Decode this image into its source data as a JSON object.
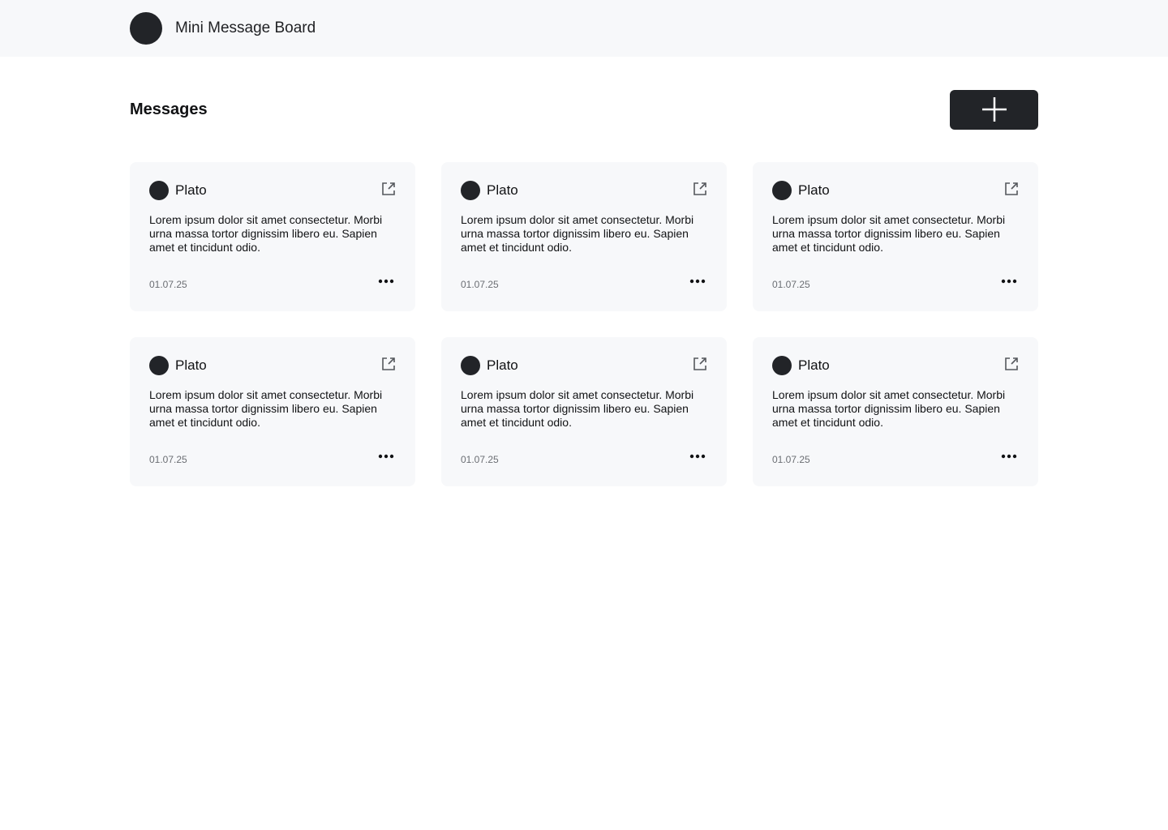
{
  "header": {
    "title": "Mini Message Board",
    "logo_icon": "circle-logo-icon"
  },
  "toolbar": {
    "title": "Messages",
    "add_icon": "plus-icon"
  },
  "messages": [
    {
      "author": "Plato",
      "text": "Lorem ipsum dolor sit amet consectetur. Morbi urna massa tortor dignissim libero eu. Sapien amet et tincidunt odio.",
      "date": "01.07.25"
    },
    {
      "author": "Plato",
      "text": "Lorem ipsum dolor sit amet consectetur. Morbi urna massa tortor dignissim libero eu. Sapien amet et tincidunt odio.",
      "date": "01.07.25"
    },
    {
      "author": "Plato",
      "text": "Lorem ipsum dolor sit amet consectetur. Morbi urna massa tortor dignissim libero eu. Sapien amet et tincidunt odio.",
      "date": "01.07.25"
    },
    {
      "author": "Plato",
      "text": "Lorem ipsum dolor sit amet consectetur. Morbi urna massa tortor dignissim libero eu. Sapien amet et tincidunt odio.",
      "date": "01.07.25"
    },
    {
      "author": "Plato",
      "text": "Lorem ipsum dolor sit amet consectetur. Morbi urna massa tortor dignissim libero eu. Sapien amet et tincidunt odio.",
      "date": "01.07.25"
    },
    {
      "author": "Plato",
      "text": "Lorem ipsum dolor sit amet consectetur. Morbi urna massa tortor dignissim libero eu. Sapien amet et tincidunt odio.",
      "date": "01.07.25"
    }
  ],
  "icons": {
    "open": "external-link-icon",
    "more": "more-horizontal-icon",
    "avatar": "avatar-icon"
  },
  "colors": {
    "header_bg": "#f7f8fa",
    "card_bg": "#f7f8fa",
    "accent_dark": "#222428",
    "date_text": "#6b6e73"
  }
}
